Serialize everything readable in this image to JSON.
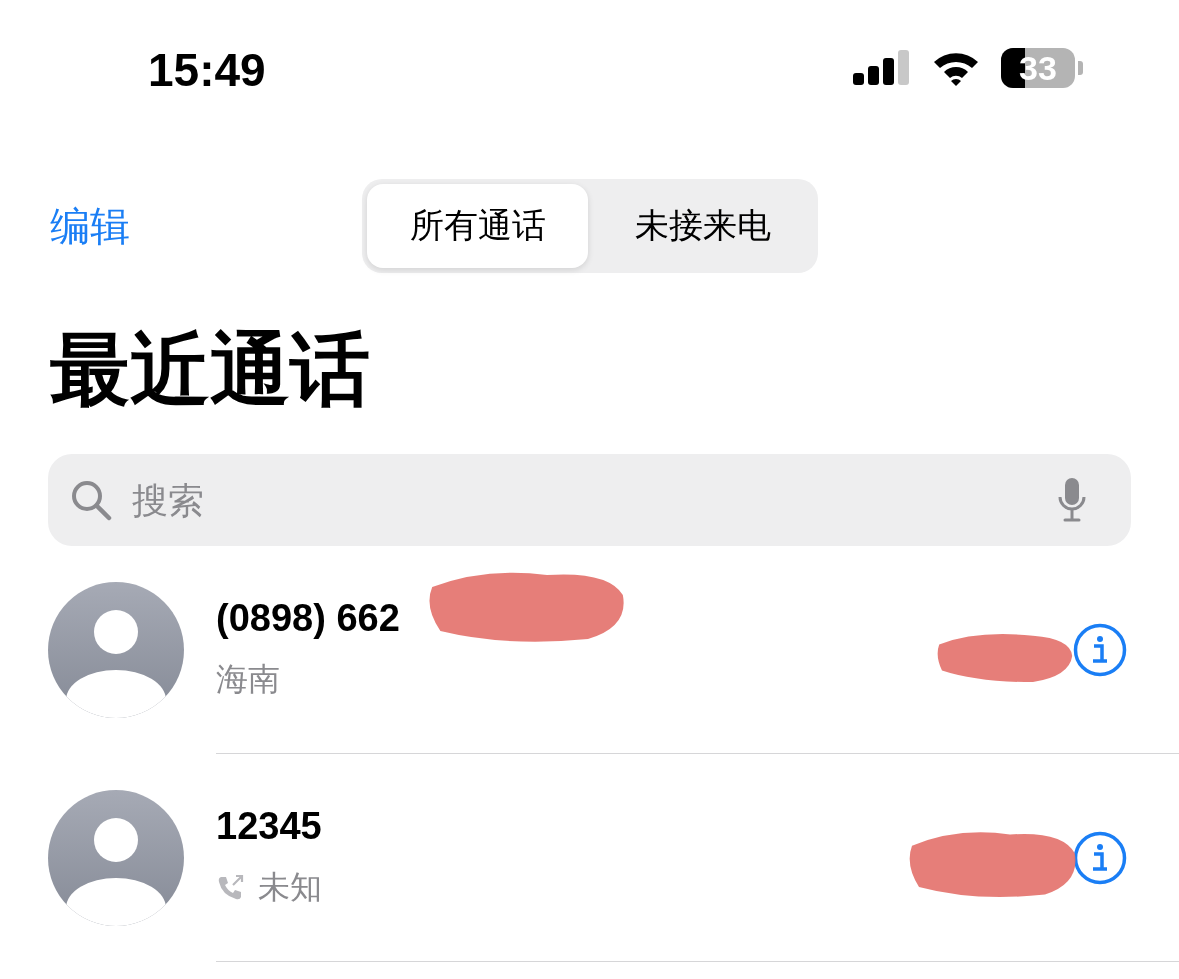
{
  "status_bar": {
    "time": "15:49",
    "battery": {
      "label": "33",
      "level": 0.33
    }
  },
  "nav": {
    "edit": "编辑",
    "segments": [
      {
        "label": "所有通话",
        "selected": true
      },
      {
        "label": "未接来电",
        "selected": false
      }
    ]
  },
  "title": "最近通话",
  "search": {
    "placeholder": "搜索"
  },
  "calls": [
    {
      "name": "(0898) 662",
      "detail": "海南",
      "outgoing": false
    },
    {
      "name": "12345",
      "detail": "未知",
      "outgoing": true
    }
  ]
}
